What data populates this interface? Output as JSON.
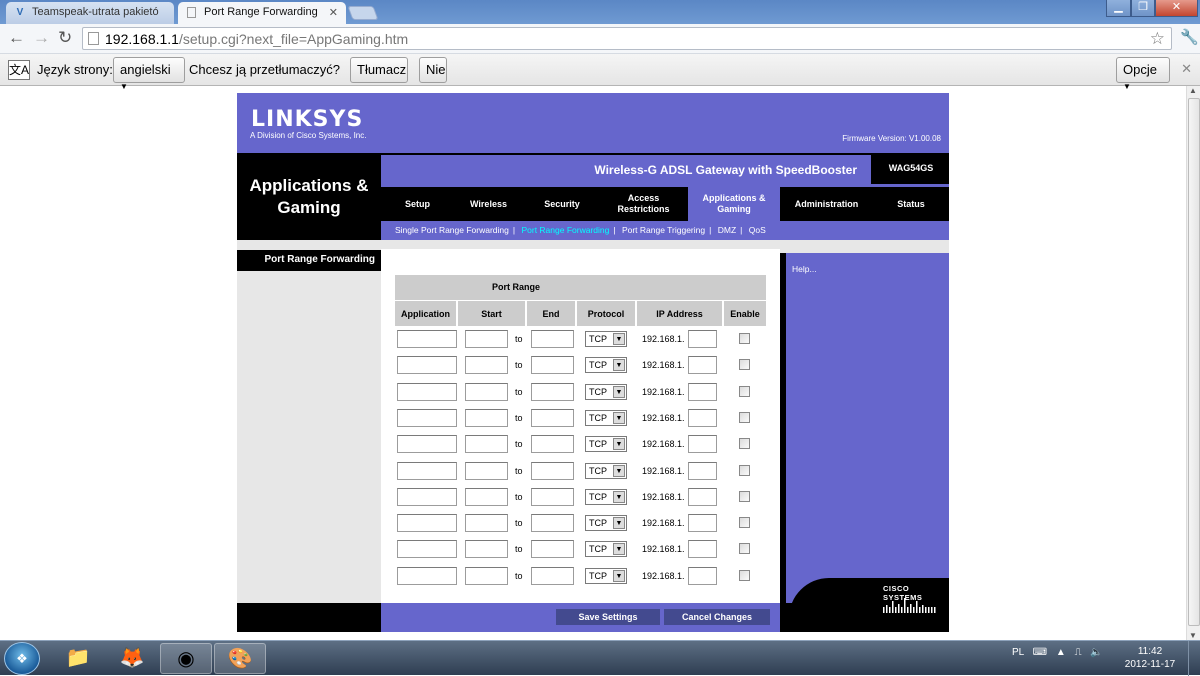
{
  "browser": {
    "tabs": [
      {
        "title": "Teamspeak-utrata pakietó",
        "icon": "v-forum-icon",
        "active": false
      },
      {
        "title": "Port Range Forwarding",
        "icon": "page-icon",
        "active": true
      }
    ],
    "url_host": "192.168.1.1",
    "url_path": "/setup.cgi?next_file=AppGaming.htm",
    "translate": {
      "label": "Język strony:",
      "language": "angielski",
      "question": "Chcesz ją przetłumaczyć?",
      "translate_btn": "Tłumacz",
      "no_btn": "Nie",
      "options_btn": "Opcje"
    }
  },
  "router": {
    "logo": "LINKSYS",
    "logo_sub": "A Division of Cisco Systems, Inc.",
    "firmware": "Firmware Version: V1.00.08",
    "section_title": "Applications & Gaming",
    "product_name": "Wireless-G ADSL Gateway with SpeedBooster",
    "model": "WAG54GS",
    "menu": [
      {
        "label": "Setup"
      },
      {
        "label": "Wireless"
      },
      {
        "label": "Security"
      },
      {
        "label": "Access Restrictions"
      },
      {
        "label": "Applications & Gaming",
        "active": true
      },
      {
        "label": "Administration"
      },
      {
        "label": "Status"
      }
    ],
    "submenu": [
      {
        "label": "Single Port Range Forwarding",
        "sep": "|"
      },
      {
        "label": "Port Range Forwarding",
        "sep": "|",
        "current": true
      },
      {
        "label": "Port Range Triggering",
        "sep": "|"
      },
      {
        "label": "DMZ",
        "sep": "|"
      },
      {
        "label": "QoS",
        "sep": ""
      }
    ],
    "left_label": "Port Range Forwarding",
    "help": "Help...",
    "table": {
      "group_header": "Port Range",
      "columns": [
        "Application",
        "Start",
        "End",
        "Protocol",
        "IP Address",
        "Enable"
      ],
      "rows": [
        {
          "application": "",
          "start": "",
          "to": "to",
          "end": "",
          "protocol": "TCP",
          "ip_prefix": "192.168.1.",
          "ip_last": "",
          "enabled": false
        },
        {
          "application": "",
          "start": "",
          "to": "to",
          "end": "",
          "protocol": "TCP",
          "ip_prefix": "192.168.1.",
          "ip_last": "",
          "enabled": false
        },
        {
          "application": "",
          "start": "",
          "to": "to",
          "end": "",
          "protocol": "TCP",
          "ip_prefix": "192.168.1.",
          "ip_last": "",
          "enabled": false
        },
        {
          "application": "",
          "start": "",
          "to": "to",
          "end": "",
          "protocol": "TCP",
          "ip_prefix": "192.168.1.",
          "ip_last": "",
          "enabled": false
        },
        {
          "application": "",
          "start": "",
          "to": "to",
          "end": "",
          "protocol": "TCP",
          "ip_prefix": "192.168.1.",
          "ip_last": "",
          "enabled": false
        },
        {
          "application": "",
          "start": "",
          "to": "to",
          "end": "",
          "protocol": "TCP",
          "ip_prefix": "192.168.1.",
          "ip_last": "",
          "enabled": false
        },
        {
          "application": "",
          "start": "",
          "to": "to",
          "end": "",
          "protocol": "TCP",
          "ip_prefix": "192.168.1.",
          "ip_last": "",
          "enabled": false
        },
        {
          "application": "",
          "start": "",
          "to": "to",
          "end": "",
          "protocol": "TCP",
          "ip_prefix": "192.168.1.",
          "ip_last": "",
          "enabled": false
        },
        {
          "application": "",
          "start": "",
          "to": "to",
          "end": "",
          "protocol": "TCP",
          "ip_prefix": "192.168.1.",
          "ip_last": "",
          "enabled": false
        },
        {
          "application": "",
          "start": "",
          "to": "to",
          "end": "",
          "protocol": "TCP",
          "ip_prefix": "192.168.1.",
          "ip_last": "",
          "enabled": false
        }
      ]
    },
    "save_btn": "Save Settings",
    "cancel_btn": "Cancel Changes",
    "cisco": "CISCO SYSTEMS"
  },
  "taskbar": {
    "apps": [
      "windows-explorer-icon",
      "firefox-icon",
      "chrome-icon",
      "paint-icon"
    ],
    "language": "PL",
    "time": "11:42",
    "date": "2012-11-17"
  },
  "colors": {
    "linksys_purple": "#6666cc",
    "submenu_current": "#00ffff",
    "button": "#434a8f"
  }
}
